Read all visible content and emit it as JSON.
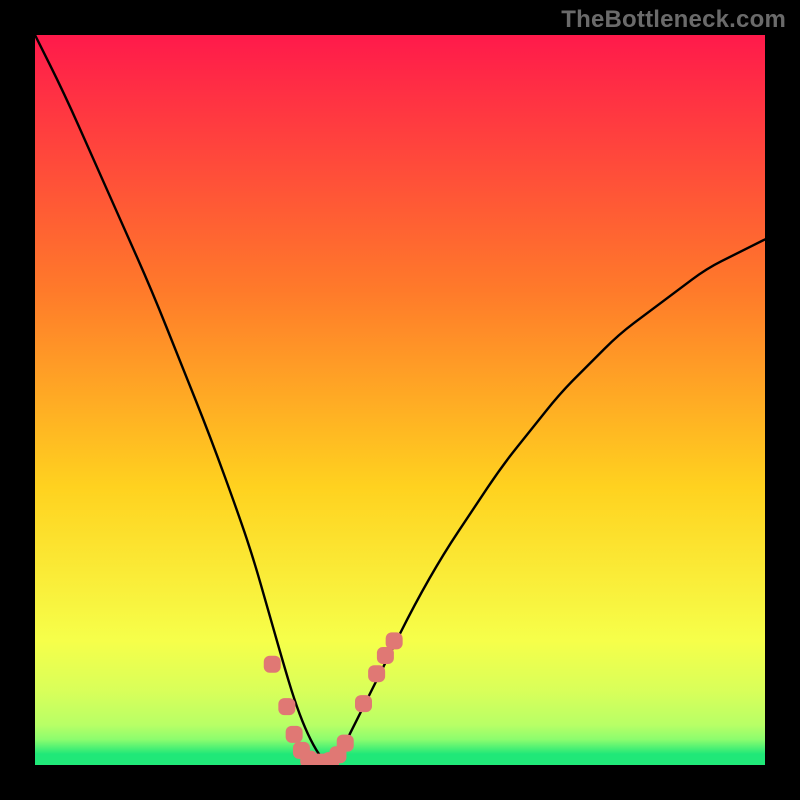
{
  "watermark": "TheBottleneck.com",
  "colors": {
    "background": "#000000",
    "gradient_top": "#ff1a4b",
    "gradient_mid1": "#ff7a2a",
    "gradient_mid2": "#ffd21f",
    "gradient_mid3": "#f6ff4a",
    "gradient_bottom": "#20e878",
    "curve": "#000000",
    "marker": "#e07874",
    "watermark": "#6a6a6a"
  },
  "chart_data": {
    "type": "line",
    "title": "",
    "xlabel": "",
    "ylabel": "",
    "xlim": [
      0,
      100
    ],
    "ylim": [
      0,
      100
    ],
    "series": [
      {
        "name": "bottleneck-curve",
        "x": [
          0,
          4,
          8,
          12,
          16,
          20,
          24,
          28,
          30,
          32,
          34,
          35.5,
          37,
          38.5,
          40,
          42,
          44,
          48,
          52,
          56,
          60,
          64,
          68,
          72,
          76,
          80,
          84,
          88,
          92,
          96,
          100
        ],
        "y": [
          100,
          92,
          83,
          74,
          65,
          55,
          45,
          34,
          28,
          21,
          14,
          9,
          5,
          2,
          0,
          2,
          6,
          14,
          22,
          29,
          35,
          41,
          46,
          51,
          55,
          59,
          62,
          65,
          68,
          70,
          72
        ]
      }
    ],
    "markers": {
      "name": "highlight-points",
      "shape": "rounded-square",
      "color": "#e07874",
      "x": [
        32.5,
        34.5,
        35.5,
        36.5,
        37.5,
        38.5,
        39.5,
        40.5,
        41.5,
        42.5,
        45.0,
        46.8,
        48.0,
        49.2
      ],
      "y": [
        13.8,
        8.0,
        4.2,
        2.0,
        0.8,
        0.4,
        0.4,
        0.6,
        1.4,
        3.0,
        8.4,
        12.5,
        15.0,
        17.0
      ]
    }
  }
}
